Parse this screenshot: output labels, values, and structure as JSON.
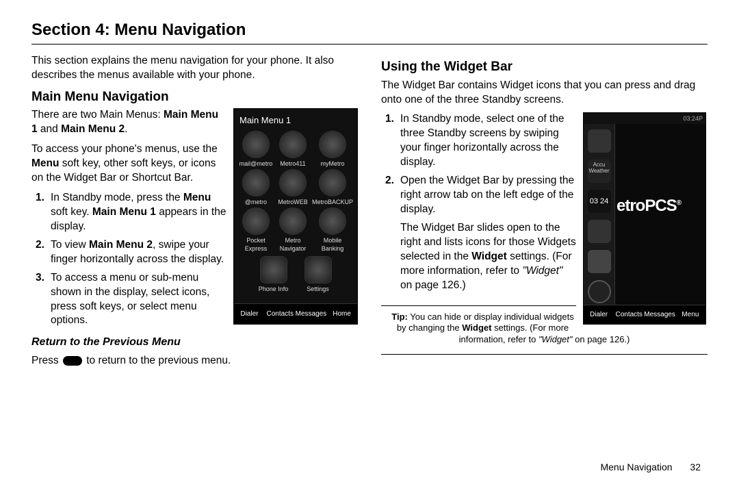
{
  "title": "Section 4: Menu Navigation",
  "left": {
    "intro": "This section explains the menu navigation for your phone. It also describes the menus available with your phone.",
    "h_main": "Main Menu Navigation",
    "menus_a": "There are two Main Menus: ",
    "menus_b": "Main Menu 1",
    "menus_c": " and ",
    "menus_d": "Main Menu 2",
    "menus_e": ".",
    "access_a": "To access your phone's menus, use the ",
    "access_b": "Menu",
    "access_c": " soft key, other soft keys, or icons on the Widget Bar or Shortcut Bar.",
    "li1_a": "In Standby mode, press the ",
    "li1_b": "Menu",
    "li1_c": " soft key. ",
    "li1_d": "Main Menu 1",
    "li1_e": " appears in the display.",
    "li2_a": "To view ",
    "li2_b": "Main Menu 2",
    "li2_c": ", swipe your finger horizontally across the display.",
    "li3": "To access a menu or sub-menu shown in the display, select icons, press soft keys, or select menu options.",
    "h_return": "Return to the Previous Menu",
    "ret_a": "Press ",
    "ret_b": " to return to the previous menu."
  },
  "right": {
    "h_widget": "Using the Widget Bar",
    "intro": "The Widget Bar contains Widget icons that you can press and drag onto one of the three Standby screens.",
    "li1": "In Standby mode, select one of the three Standby screens by swiping your finger horizontally across the display.",
    "li2": "Open the Widget Bar by pressing the right arrow tab on the left edge of the display.",
    "p2_a": "The Widget Bar slides open to the right and lists icons for those Widgets selected in the ",
    "p2_b": "Widget",
    "p2_c": " settings. (For more information, refer to ",
    "p2_d": "\"Widget\"",
    "p2_e": " on page 126.)",
    "tip_a": "Tip:",
    "tip_b": " You can hide or display individual widgets by changing the ",
    "tip_c": "Widget",
    "tip_d": " settings. (For more information, refer to ",
    "tip_e": "\"Widget\"",
    "tip_f": "  on page 126.)"
  },
  "phone1": {
    "title": "Main Menu 1",
    "icons": [
      "mail@metro",
      "Metro411",
      "myMetro",
      "@metro",
      "MetroWEB",
      "MetroBACKUP",
      "Pocket Express",
      "Metro Navigator",
      "Mobile Banking"
    ],
    "row2": [
      "Phone Info",
      "Settings"
    ],
    "soft": [
      "Dialer",
      "Contacts",
      "Messages",
      "Home"
    ]
  },
  "phone2": {
    "status": "03:24P",
    "brand": "etroPCS",
    "time": "03 24",
    "soft": [
      "Dialer",
      "Contacts",
      "Messages",
      "Menu"
    ]
  },
  "footer": {
    "label": "Menu Navigation",
    "page": "32"
  },
  "nums": {
    "n1": "1.",
    "n2": "2.",
    "n3": "3."
  }
}
